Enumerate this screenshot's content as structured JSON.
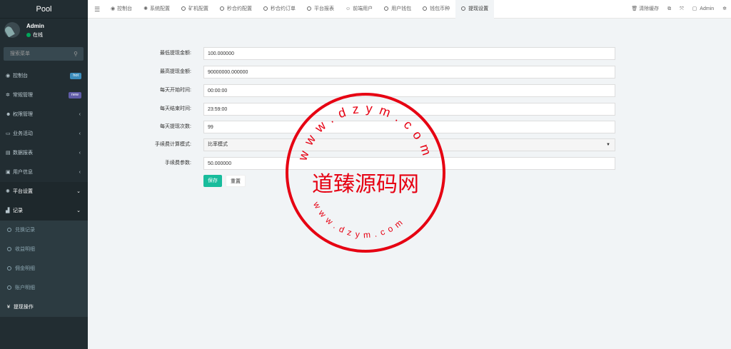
{
  "sidebar": {
    "brand": "Pool",
    "user": {
      "name": "Admin",
      "status": "在线"
    },
    "search_placeholder": "搜索菜单",
    "items": [
      {
        "label": "控制台",
        "icon": "dashboard-icon",
        "badge": "hot",
        "badge_color": "#3c8dbc"
      },
      {
        "label": "常规管理",
        "icon": "cogs-icon",
        "badge": "new",
        "badge_color": "#605ca8"
      },
      {
        "label": "权限管理",
        "icon": "group-icon",
        "arrow": "‹"
      },
      {
        "label": "业务活动",
        "icon": "id-card-icon",
        "arrow": "‹"
      },
      {
        "label": "数据报表",
        "icon": "file-icon",
        "arrow": "‹"
      },
      {
        "label": "用户信息",
        "icon": "user-icon",
        "arrow": "‹"
      },
      {
        "label": "平台设置",
        "icon": "gear-icon",
        "arrow": "⌄"
      },
      {
        "label": "记录",
        "icon": "chart-icon",
        "arrow": "⌄"
      }
    ],
    "subitems": [
      {
        "label": "兑换记录"
      },
      {
        "label": "收益明细"
      },
      {
        "label": "佣金明细"
      },
      {
        "label": "账户明细"
      },
      {
        "label": "提现操作",
        "icon": "yen-icon"
      }
    ]
  },
  "topbar": {
    "tabs": [
      {
        "label": "控制台",
        "icon": "dashboard-icon"
      },
      {
        "label": "系统配置",
        "icon": "gear-icon"
      },
      {
        "label": "矿机配置"
      },
      {
        "label": "秒合约配置"
      },
      {
        "label": "秒合约订单"
      },
      {
        "label": "平台报表"
      },
      {
        "label": "前端用户",
        "icon": "user-circle-icon"
      },
      {
        "label": "用户钱包"
      },
      {
        "label": "钱包币种"
      },
      {
        "label": "提现设置",
        "active": true
      }
    ],
    "clear_cache": "清除缓存",
    "admin": "Admin"
  },
  "form": {
    "rows": [
      {
        "label": "最低提现金额:",
        "value": "100.000000"
      },
      {
        "label": "最高提现金额:",
        "value": "90000000.000000"
      },
      {
        "label": "每天开始时间:",
        "value": "00:00:00"
      },
      {
        "label": "每天结束时间:",
        "value": "23:59:00"
      },
      {
        "label": "每天提现次数:",
        "value": "99"
      },
      {
        "label": "手续费计算模式:",
        "value": "比率模式",
        "type": "select"
      },
      {
        "label": "手续费参数:",
        "value": "50.000000"
      }
    ],
    "save": "保存",
    "reset": "重置"
  },
  "watermark": {
    "title": "道臻源码网",
    "ring_text": "www.dzym.com"
  }
}
